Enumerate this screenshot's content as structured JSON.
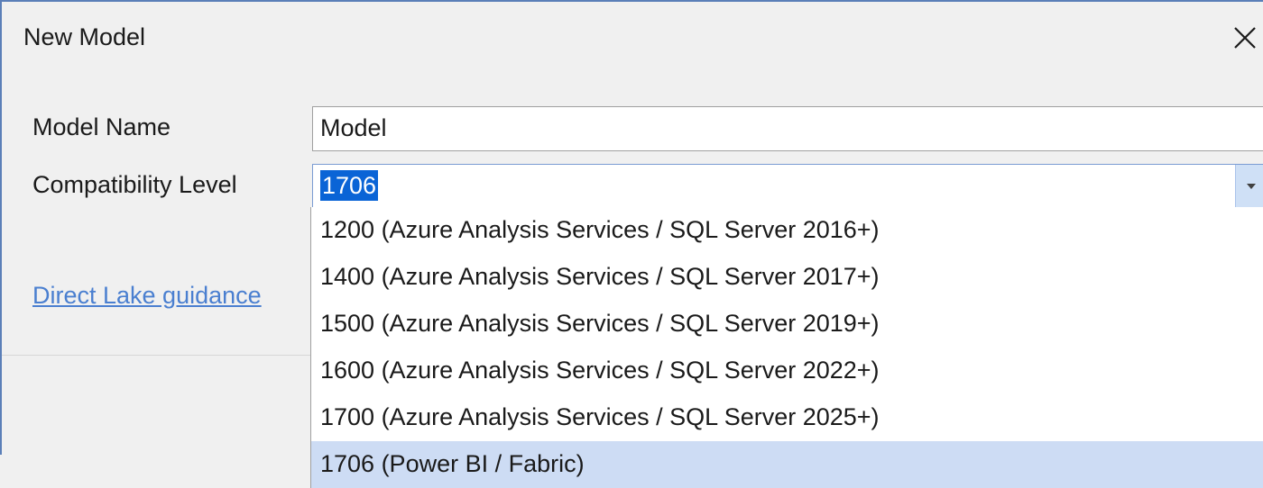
{
  "dialog": {
    "title": "New Model",
    "model_name_label": "Model Name",
    "model_name_value": "Model",
    "compat_label": "Compatibility Level",
    "compat_value": "1706",
    "link_text": "Direct Lake guidance"
  },
  "dropdown": {
    "options": [
      {
        "label": "1200 (Azure Analysis Services / SQL Server 2016+)",
        "selected": false
      },
      {
        "label": "1400 (Azure Analysis Services / SQL Server 2017+)",
        "selected": false
      },
      {
        "label": "1500 (Azure Analysis Services / SQL Server 2019+)",
        "selected": false
      },
      {
        "label": "1600 (Azure Analysis Services / SQL Server 2022+)",
        "selected": false
      },
      {
        "label": "1700 (Azure Analysis Services / SQL Server 2025+)",
        "selected": false
      },
      {
        "label": "1706 (Power BI / Fabric)",
        "selected": true
      }
    ]
  },
  "colors": {
    "accent": "#0a64d6",
    "selected_row": "#cddcf4",
    "link": "#4a7fd0"
  },
  "icons": {
    "close": "close-icon",
    "dropdown": "chevron-down-icon"
  }
}
